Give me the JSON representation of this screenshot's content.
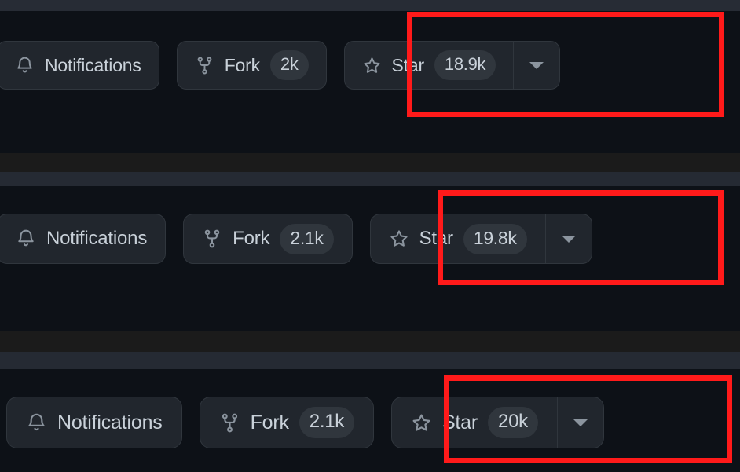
{
  "theme": {
    "page_background": "#0d1117",
    "button_background": "#21262d",
    "button_border": "#30363d",
    "counter_background": "#30363d",
    "text_color": "#c9d1d9",
    "icon_color": "#8b949e",
    "highlight_color": "#ff1a1a",
    "chrome_band_color": "#252a33"
  },
  "captures": [
    {
      "id": "capture-1",
      "notifications": {
        "label": "Notifications",
        "icon": "bell-icon"
      },
      "fork": {
        "label": "Fork",
        "count": "2k",
        "icon": "repo-forked-icon"
      },
      "star": {
        "label": "Star",
        "count": "18.9k",
        "icon": "star-icon",
        "caret_icon": "chevron-down-icon"
      }
    },
    {
      "id": "capture-2",
      "notifications": {
        "label": "Notifications",
        "icon": "bell-icon"
      },
      "fork": {
        "label": "Fork",
        "count": "2.1k",
        "icon": "repo-forked-icon"
      },
      "star": {
        "label": "Star",
        "count": "19.8k",
        "icon": "star-icon",
        "caret_icon": "chevron-down-icon"
      }
    },
    {
      "id": "capture-3",
      "notifications": {
        "label": "Notifications",
        "icon": "bell-icon"
      },
      "fork": {
        "label": "Fork",
        "count": "2.1k",
        "icon": "repo-forked-icon"
      },
      "star": {
        "label": "Star",
        "count": "20k",
        "icon": "star-icon",
        "caret_icon": "chevron-down-icon"
      }
    }
  ]
}
